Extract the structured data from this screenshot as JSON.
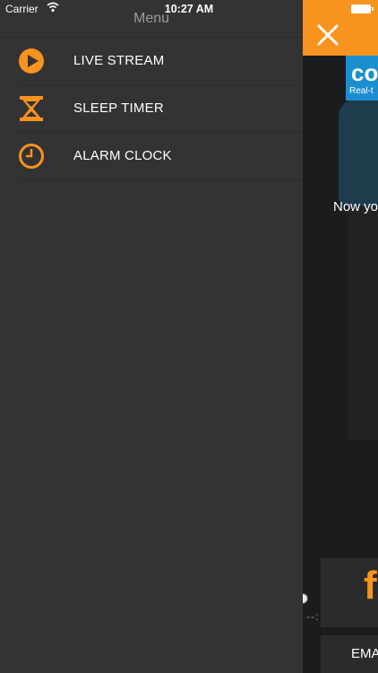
{
  "status_bar": {
    "carrier": "Carrier",
    "time": "10:27 AM"
  },
  "menu": {
    "title": "Menu",
    "accent_color": "#f7931e",
    "items": [
      {
        "label": "LIVE STREAM",
        "icon": "play-circle-icon"
      },
      {
        "label": "SLEEP TIMER",
        "icon": "hourglass-icon"
      },
      {
        "label": "ALARM CLOCK",
        "icon": "clock-icon"
      }
    ]
  },
  "content": {
    "logo_text": "co",
    "logo_subtext": "Real-t",
    "message": "Now yo",
    "facebook_label": "f",
    "email_label": "EMA",
    "pager_dashes": "--:"
  }
}
